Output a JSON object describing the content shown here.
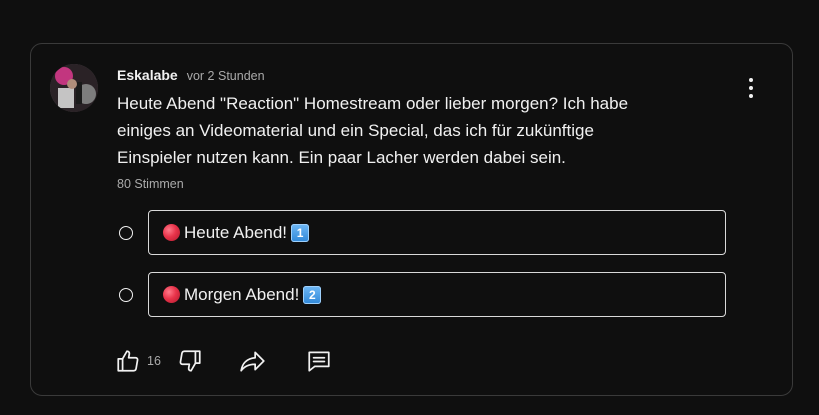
{
  "post": {
    "author": "Eskalabe",
    "time": "vor 2 Stunden",
    "text_lines": [
      "Heute Abend \"Reaction\" Homestream oder lieber morgen? Ich habe",
      "einiges an Videomaterial und ein Special, das ich für zukünftige",
      "Einspieler nutzen kann. Ein paar Lacher werden dabei sein."
    ],
    "votes": "80 Stimmen"
  },
  "poll": {
    "options": [
      {
        "label": "Heute Abend!",
        "badge": "1",
        "emoji_icon": "red-circle-icon",
        "badge_icon": "keycap-1-icon"
      },
      {
        "label": "Morgen Abend!",
        "badge": "2",
        "emoji_icon": "red-circle-icon",
        "badge_icon": "keycap-2-icon"
      }
    ]
  },
  "actions": {
    "like_count": "16",
    "icons": [
      "thumbs-up-icon",
      "thumbs-down-icon",
      "share-icon",
      "comment-icon"
    ]
  },
  "colors": {
    "background": "#0f0f0f",
    "card_border": "#3a3a3a",
    "text_primary": "#f1f1f1",
    "text_secondary": "#aaaaaa",
    "option_border": "#d9d9d9",
    "red_emoji": "#e8334a",
    "keycap_blue": "#2f87d8"
  }
}
